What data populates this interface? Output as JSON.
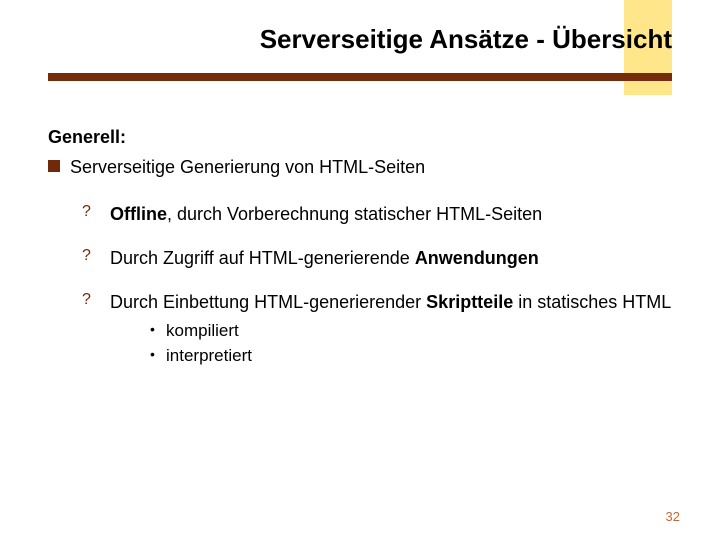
{
  "title": "Serverseitige Ansätze - Übersicht",
  "section_label": "Generell:",
  "bullet1": "Serverseitige Generierung von HTML-Seiten",
  "sub1_pre": "Offline",
  "sub1_rest": ", durch Vorberechnung statischer HTML-Seiten",
  "sub2_pre": "Durch Zugriff auf HTML-generierende ",
  "sub2_bold": "Anwendungen",
  "sub3_pre": "Durch Einbettung HTML-generierender ",
  "sub3_bold": "Skriptteile",
  "sub3_rest": " in statisches HTML",
  "subsub1": "kompiliert",
  "subsub2": "interpretiert",
  "page_number": "32"
}
